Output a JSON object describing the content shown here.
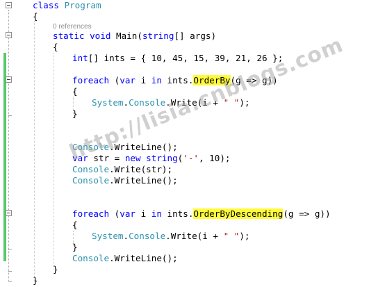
{
  "code": {
    "class_line": {
      "kw": "class",
      "name": "Program"
    },
    "open_brace_1": "{",
    "references": "0 references",
    "main_sig": {
      "mods": "static void",
      "name": "Main",
      "args_pre": "(",
      "type": "string",
      "args_post": "[] args)"
    },
    "open_brace_2": "{",
    "ints_line": {
      "type": "int",
      "rest": "[] ints = { 10, 45, 15, 39, 21, 26 };"
    },
    "foreach1": {
      "kw": "foreach",
      "pre": " (",
      "kw_var": "var",
      "i": " i ",
      "kw_in": "in",
      "mid": " ints.",
      "method": "OrderBy",
      "post": "(g => g))"
    },
    "brace_open_3": "{",
    "write1": {
      "cls1": "System",
      "dot1": ".",
      "cls2": "Console",
      "dot2": ".Write(i + ",
      "str": "\" \"",
      "end": ");"
    },
    "brace_close_3": "}",
    "writeline1": {
      "cls": "Console",
      "rest": ".WriteLine();"
    },
    "str_line": {
      "kw_var": "var",
      "mid": " str = ",
      "kw_new": "new",
      "sp": " ",
      "kw_string": "string",
      "open": "(",
      "char": "'-'",
      "end": ", 10);"
    },
    "write2": {
      "cls": "Console",
      "rest": ".Write(str);"
    },
    "writeline2": {
      "cls": "Console",
      "rest": ".WriteLine();"
    },
    "foreach2": {
      "kw": "foreach",
      "pre": " (",
      "kw_var": "var",
      "i": " i ",
      "kw_in": "in",
      "mid": " ints.",
      "method": "OrderByDescending",
      "post": "(g => g))"
    },
    "brace_open_4": "{",
    "write3": {
      "cls1": "System",
      "dot1": ".",
      "cls2": "Console",
      "dot2": ".Write(i + ",
      "str": "\" \"",
      "end": ");"
    },
    "brace_close_4": "}",
    "writeline3": {
      "cls": "Console",
      "rest": ".WriteLine();"
    },
    "close_brace_2": "}",
    "close_brace_1": "}"
  },
  "watermark": "http://lisia.cnblogs.com",
  "colors": {
    "keyword": "#0000ff",
    "type": "#2b91af",
    "string": "#a31515",
    "highlight": "#fffb3b",
    "change_bar": "#57c96b"
  }
}
